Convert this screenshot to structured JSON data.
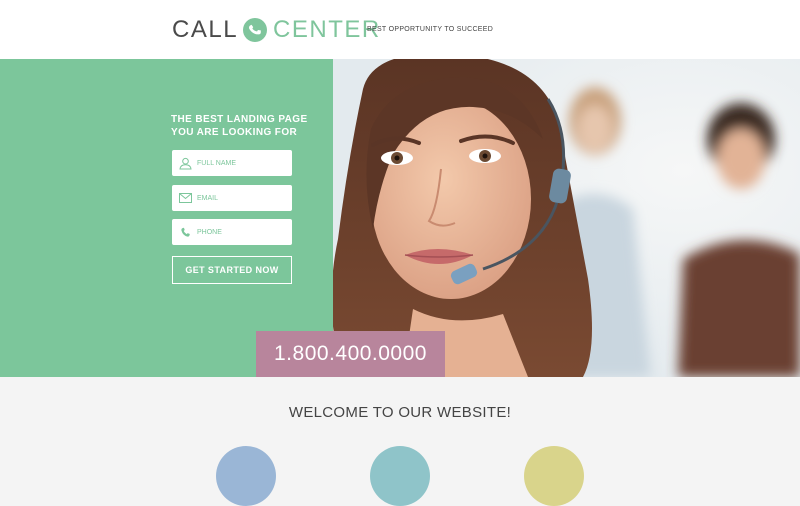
{
  "header": {
    "logo_left": "CALL",
    "logo_right": "CENTER",
    "tagline": "BEST OPPORTUNITY TO SUCCEED"
  },
  "hero": {
    "title_line1": "THE BEST LANDING PAGE",
    "title_line2": "YOU ARE LOOKING FOR",
    "form": {
      "full_name_placeholder": "FULL NAME",
      "email_placeholder": "EMAIL",
      "phone_placeholder": "PHONE",
      "cta_label": "GET STARTED NOW"
    },
    "phone_number": "1.800.400.0000"
  },
  "welcome": {
    "heading": "WELCOME TO OUR WEBSITE!"
  },
  "colors": {
    "brand_green": "#7cc69b",
    "phone_box": "#b8859c",
    "text_dark": "#444444"
  },
  "icons": [
    "phone-icon",
    "user-icon",
    "envelope-icon",
    "phone-icon"
  ]
}
